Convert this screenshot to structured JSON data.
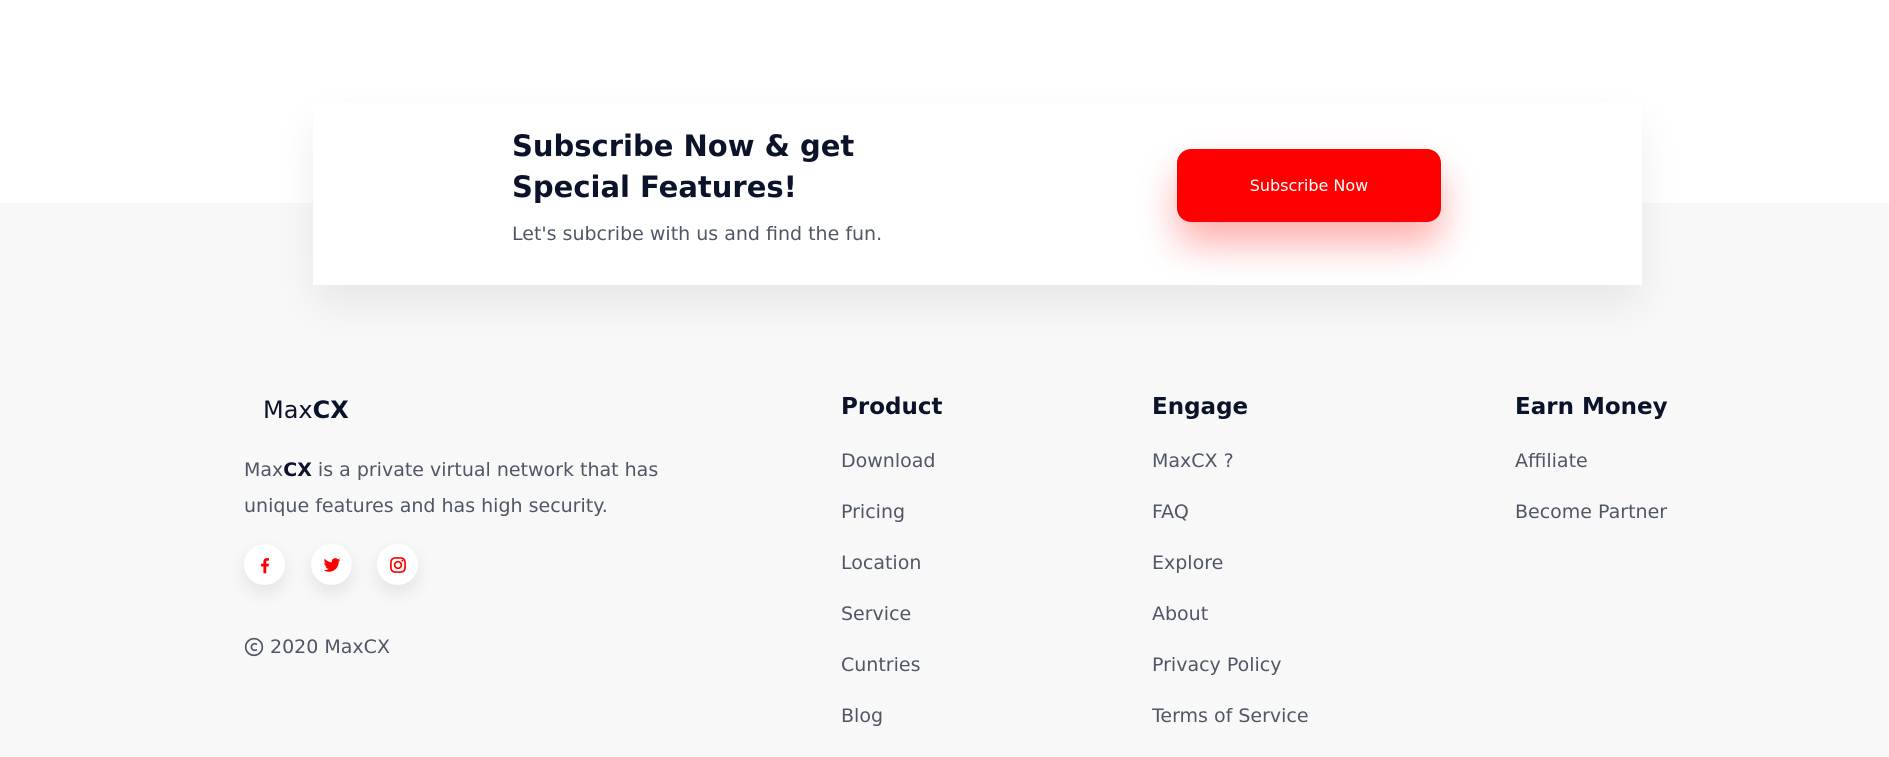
{
  "subscribe": {
    "title": "Subscribe Now & get Special Features!",
    "text": "Let's subcribe with us and find the fun.",
    "button_label": "Subscribe Now"
  },
  "brand": {
    "name_light": "Max",
    "name_bold": "CX"
  },
  "about": {
    "brand_light": "Max",
    "brand_bold": "CX",
    "text": " is a private virtual network that has unique features and has high security."
  },
  "social": [
    "facebook-icon",
    "twitter-icon",
    "instagram-icon"
  ],
  "copyright": "2020 MaxCX",
  "columns": [
    {
      "title": "Product",
      "links": [
        "Download",
        "Pricing",
        "Location",
        "Service",
        "Cuntries",
        "Blog"
      ]
    },
    {
      "title": "Engage",
      "links": [
        "MaxCX ?",
        "FAQ",
        "Explore",
        "About",
        "Privacy Policy",
        "Terms of Service"
      ]
    },
    {
      "title": "Earn Money",
      "links": [
        "Affiliate",
        "Become Partner"
      ]
    }
  ],
  "colors": {
    "accent": "#ff0000",
    "heading": "#0b132a",
    "muted": "#4f5665",
    "footer_bg": "#f8f8f8"
  }
}
